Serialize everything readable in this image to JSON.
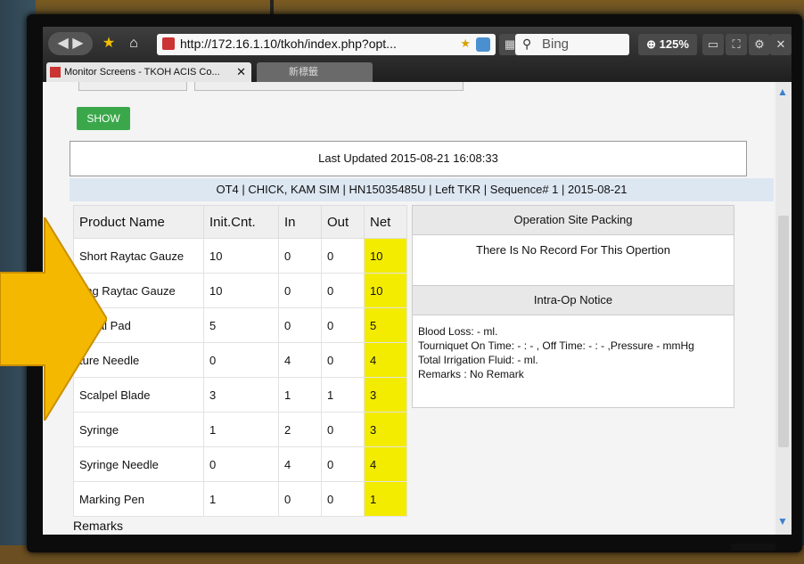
{
  "browser": {
    "url": "http://172.16.1.10/tkoh/index.php?opt...",
    "search_placeholder": "Bing",
    "zoom": "125%",
    "tabs": [
      {
        "label": "Monitor Screens - TKOH ACIS Co..."
      },
      {
        "label": "新標籤"
      }
    ]
  },
  "page": {
    "show_button": "SHOW",
    "last_updated": "Last Updated 2015-08-21 16:08:33",
    "case_info": "OT4 | CHICK, KAM SIM | HN15035485U | Left TKR | Sequence# 1 | 2015-08-21",
    "table": {
      "headers": [
        "Product Name",
        "Init.Cnt.",
        "In",
        "Out",
        "Net"
      ],
      "rows": [
        [
          "Short Raytac Gauze",
          "10",
          "0",
          "0",
          "10"
        ],
        [
          "ong Raytac Gauze",
          "10",
          "0",
          "0",
          "10"
        ],
        [
          "minal Pad",
          "5",
          "0",
          "0",
          "5"
        ],
        [
          "ture Needle",
          "0",
          "4",
          "0",
          "4"
        ],
        [
          "Scalpel Blade",
          "3",
          "1",
          "1",
          "3"
        ],
        [
          "Syringe",
          "1",
          "2",
          "0",
          "3"
        ],
        [
          "Syringe Needle",
          "0",
          "4",
          "0",
          "4"
        ],
        [
          "Marking Pen",
          "1",
          "0",
          "0",
          "1"
        ]
      ]
    },
    "remarks_heading": "Remarks",
    "packing": {
      "title": "Operation Site Packing",
      "message": "There Is No Record For This Opertion"
    },
    "notice": {
      "title": "Intra-Op Notice",
      "lines": [
        "Blood Loss: - ml.",
        "Tourniquet On Time: - : - , Off Time: - : - ,Pressure - mmHg",
        "Total Irrigation Fluid: - ml.",
        "Remarks : No Remark"
      ]
    }
  },
  "colors": {
    "net_highlight": "#f4ec00",
    "show_button": "#3aa84a",
    "arrow": "#f5b800"
  }
}
